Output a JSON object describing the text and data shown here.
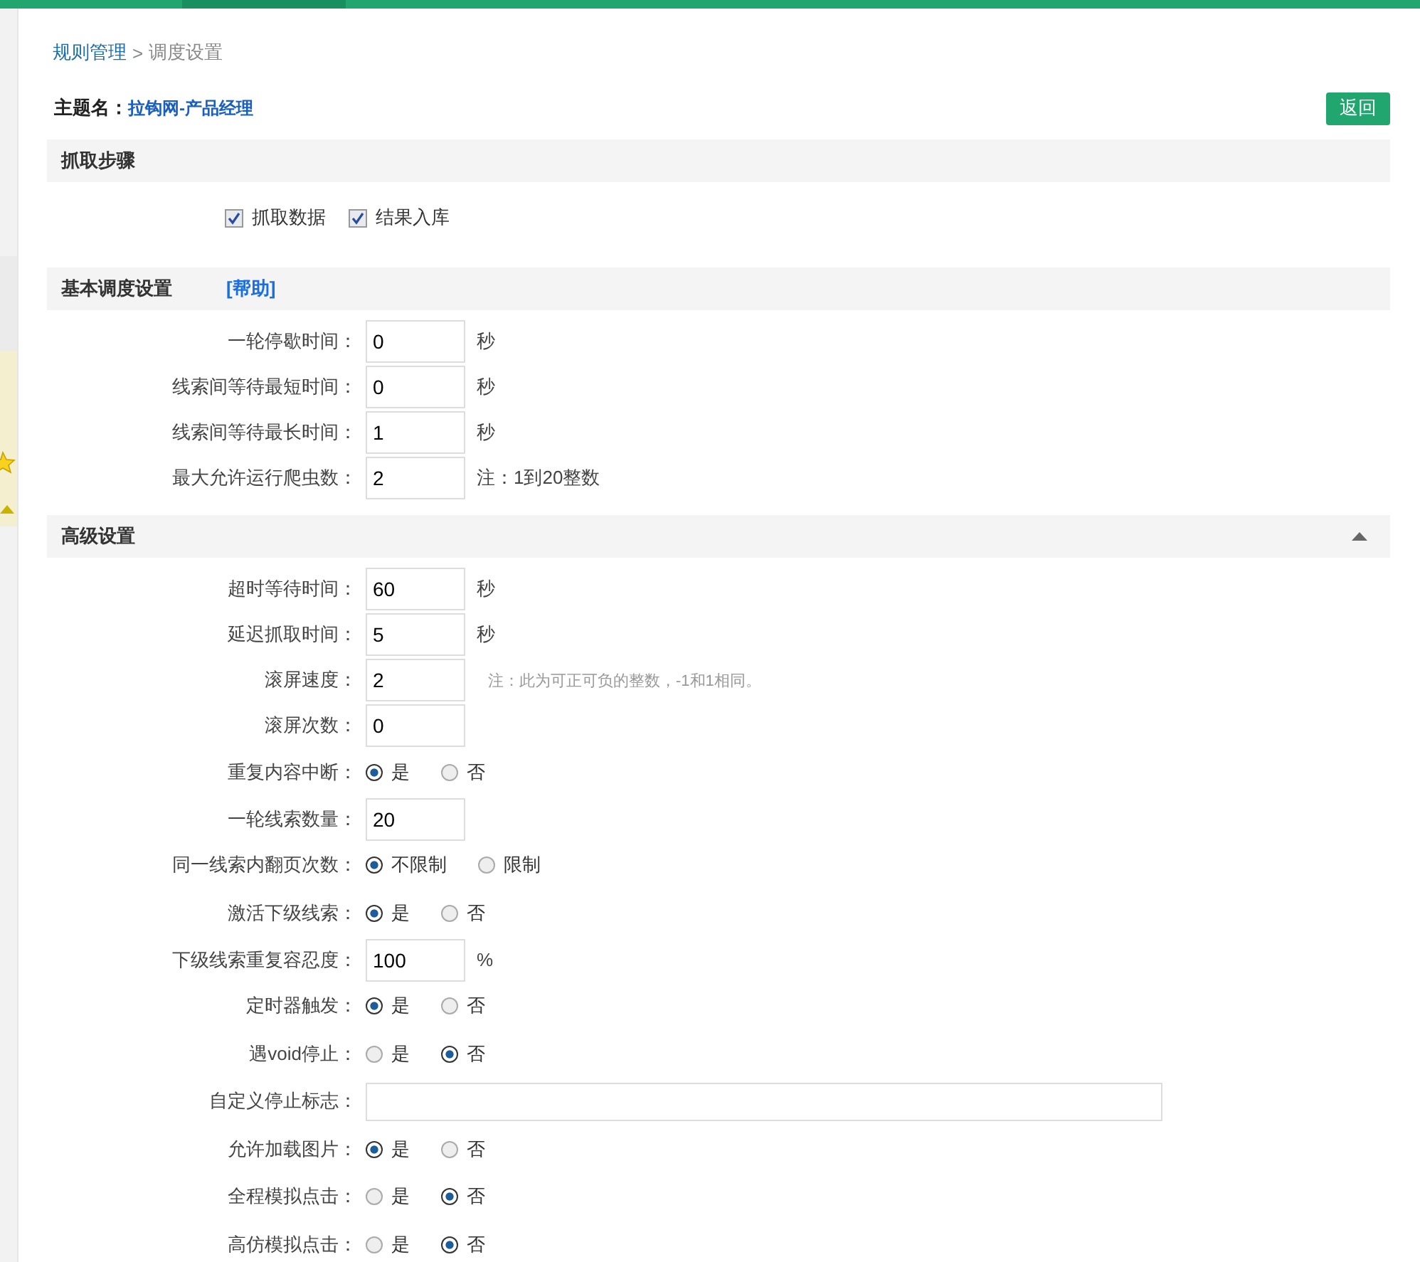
{
  "breadcrumb": {
    "link": "规则管理",
    "separator": ">",
    "current": "调度设置"
  },
  "topic": {
    "label": "主题名：",
    "value": "拉钩网-产品经理"
  },
  "back_button": "返回",
  "steps": {
    "title": "抓取步骤",
    "options": [
      {
        "label": "抓取数据",
        "checked": true
      },
      {
        "label": "结果入库",
        "checked": true
      }
    ]
  },
  "sections": [
    {
      "title": "基本调度设置",
      "help": "[帮助]",
      "rows": [
        {
          "kind": "text",
          "label": "一轮停歇时间：",
          "value": "0",
          "unit": "秒"
        },
        {
          "kind": "text",
          "label": "线索间等待最短时间：",
          "value": "0",
          "unit": "秒"
        },
        {
          "kind": "text",
          "label": "线索间等待最长时间：",
          "value": "1",
          "unit": "秒"
        },
        {
          "kind": "text",
          "label": "最大允许运行爬虫数：",
          "value": "2",
          "unit": "注：1到20整数"
        }
      ]
    },
    {
      "title": "高级设置",
      "expanded": true,
      "rows": [
        {
          "kind": "text",
          "label": "超时等待时间：",
          "value": "60",
          "unit": "秒"
        },
        {
          "kind": "text",
          "label": "延迟抓取时间：",
          "value": "5",
          "unit": "秒"
        },
        {
          "kind": "text",
          "label": "滚屏速度：",
          "value": "2",
          "note": "注：此为可正可负的整数，-1和1相同。"
        },
        {
          "kind": "text",
          "label": "滚屏次数：",
          "value": "0"
        },
        {
          "kind": "radio",
          "label": "重复内容中断：",
          "options": [
            {
              "label": "是",
              "selected": true
            },
            {
              "label": "否",
              "selected": false
            }
          ]
        },
        {
          "kind": "text",
          "label": "一轮线索数量：",
          "value": "20"
        },
        {
          "kind": "radio",
          "label": "同一线索内翻页次数：",
          "options": [
            {
              "label": "不限制",
              "selected": true
            },
            {
              "label": "限制",
              "selected": false
            }
          ]
        },
        {
          "kind": "radio",
          "label": "激活下级线索：",
          "options": [
            {
              "label": "是",
              "selected": true
            },
            {
              "label": "否",
              "selected": false
            }
          ]
        },
        {
          "kind": "text",
          "label": "下级线索重复容忍度：",
          "value": "100",
          "unit": "%"
        },
        {
          "kind": "radio",
          "label": "定时器触发：",
          "options": [
            {
              "label": "是",
              "selected": true
            },
            {
              "label": "否",
              "selected": false
            }
          ]
        },
        {
          "kind": "radio",
          "label": "遇void停止：",
          "options": [
            {
              "label": "是",
              "selected": false
            },
            {
              "label": "否",
              "selected": true
            }
          ]
        },
        {
          "kind": "wide",
          "label": "自定义停止标志："
        },
        {
          "kind": "radio",
          "label": "允许加载图片：",
          "options": [
            {
              "label": "是",
              "selected": true
            },
            {
              "label": "否",
              "selected": false
            }
          ]
        },
        {
          "kind": "radio",
          "label": "全程模拟点击：",
          "options": [
            {
              "label": "是",
              "selected": false
            },
            {
              "label": "否",
              "selected": true
            }
          ]
        },
        {
          "kind": "radio",
          "label": "高仿模拟点击：",
          "options": [
            {
              "label": "是",
              "selected": false
            },
            {
              "label": "否",
              "selected": true
            }
          ]
        }
      ]
    }
  ]
}
